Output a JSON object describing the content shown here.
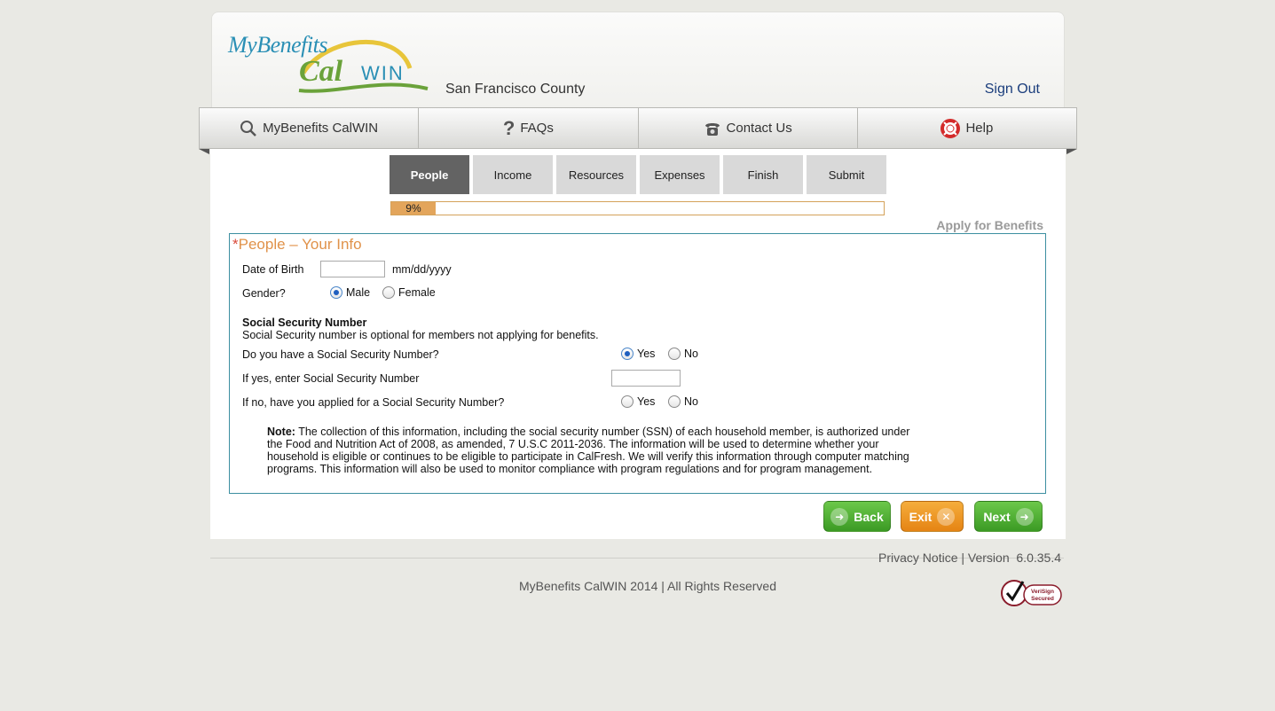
{
  "header": {
    "logo_text": "MyBenefits CalWIN",
    "county": "San Francisco County",
    "sign_out": "Sign Out"
  },
  "nav": {
    "items": [
      {
        "label": "MyBenefits CalWIN",
        "icon": "search-icon"
      },
      {
        "label": "FAQs",
        "icon": "question-icon"
      },
      {
        "label": "Contact Us",
        "icon": "phone-icon"
      },
      {
        "label": "Help",
        "icon": "lifebuoy-icon"
      }
    ]
  },
  "steps": {
    "items": [
      "People",
      "Income",
      "Resources",
      "Expenses",
      "Finish",
      "Submit"
    ],
    "active": "People"
  },
  "progress": {
    "label": "9%",
    "value": 0.09
  },
  "apply_label": "Apply for Benefits",
  "form": {
    "required_mark": "*",
    "title": "People – Your Info",
    "dob_label": "Date of Birth",
    "dob_value": "",
    "dob_hint": "mm/dd/yyyy",
    "gender_label": "Gender?",
    "gender_male": "Male",
    "gender_female": "Female",
    "gender_selected": "Male",
    "ssn_heading": "Social Security Number",
    "ssn_optional": "Social Security number is optional for members not applying for benefits.",
    "ssn_have_q": "Do you have a Social Security Number?",
    "ssn_have_yes": "Yes",
    "ssn_have_no": "No",
    "ssn_have_selected": "Yes",
    "ssn_enter_label": "If yes, enter Social Security Number",
    "ssn_enter_value": "",
    "ssn_applied_q": "If no, have you applied for a Social Security Number?",
    "ssn_applied_yes": "Yes",
    "ssn_applied_no": "No",
    "note_label": "Note:",
    "note_text": "The collection of this information, including the social security number (SSN) of each household member, is authorized under the Food and Nutrition Act of 2008, as amended, 7 U.S.C 2011-2036. The information will be used to determine whether your household is eligible or continues to be eligible to participate in CalFresh. We will verify this information through computer matching programs. This information will also be used to monitor compliance with program regulations and for program management."
  },
  "buttons": {
    "back": "Back",
    "exit": "Exit",
    "next": "Next"
  },
  "footer": {
    "privacy": "Privacy Notice",
    "separator": "|",
    "version_label": "Version",
    "version": "6.0.35.4",
    "copyright": "MyBenefits CalWIN 2014 | All Rights Reserved",
    "badge_text": "VeriSign Secured"
  },
  "colors": {
    "accent_orange": "#e0924a",
    "form_border": "#3c8fa0",
    "link_blue": "#1a3d7c",
    "active_step": "#636363",
    "progress_fill": "#e3a55b"
  }
}
